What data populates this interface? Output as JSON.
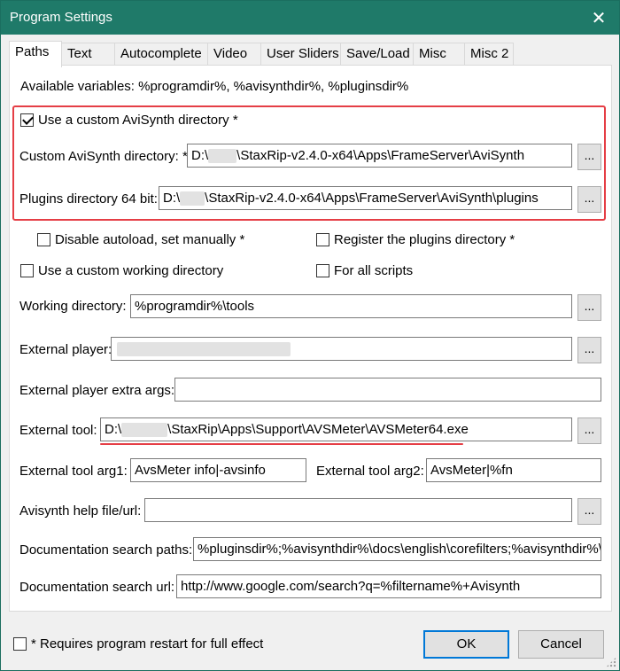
{
  "window": {
    "title": "Program Settings",
    "close_glyph": "✕"
  },
  "tabs": [
    {
      "label": "Paths",
      "active": true
    },
    {
      "label": "Text"
    },
    {
      "label": "Autocomplete"
    },
    {
      "label": "Video"
    },
    {
      "label": "User Sliders"
    },
    {
      "label": "Save/Load"
    },
    {
      "label": "Misc"
    },
    {
      "label": "Misc 2"
    }
  ],
  "paths": {
    "available_vars": "Available variables: %programdir%, %avisynthdir%, %pluginsdir%",
    "use_custom_avisynth_label": "Use a custom AviSynth directory *",
    "use_custom_avisynth_checked": true,
    "custom_avisynth_dir_label": "Custom AviSynth directory: *",
    "custom_avisynth_dir_prefix": "D:\\",
    "custom_avisynth_dir_suffix": "\\StaxRip-v2.4.0-x64\\Apps\\FrameServer\\AviSynth",
    "plugins_dir_label": "Plugins directory 64 bit:",
    "plugins_dir_prefix": "D:\\",
    "plugins_dir_suffix": "\\StaxRip-v2.4.0-x64\\Apps\\FrameServer\\AviSynth\\plugins",
    "disable_autoload_label": "Disable autoload, set manually *",
    "register_plugins_label": "Register the plugins directory *",
    "use_custom_working_label": "Use a custom working directory",
    "for_all_scripts_label": "For all scripts",
    "working_dir_label": "Working directory:",
    "working_dir_value": "%programdir%\\tools",
    "external_player_label": "External player:",
    "external_player_extra_label": "External player extra args:",
    "external_tool_label": "External tool:",
    "external_tool_prefix": "D:\\",
    "external_tool_suffix": "\\StaxRip\\Apps\\Support\\AVSMeter\\AVSMeter64.exe",
    "tool_arg1_label": "External tool arg1:",
    "tool_arg1_value": "AvsMeter info|-avsinfo",
    "tool_arg2_label": "External tool arg2:",
    "tool_arg2_value": "AvsMeter|%fn",
    "help_file_label": "Avisynth help file/url:",
    "doc_search_paths_label": "Documentation search paths:",
    "doc_search_paths_value": "%pluginsdir%;%avisynthdir%\\docs\\english\\corefilters;%avisynthdir%\\c",
    "doc_search_url_label": "Documentation search url:",
    "doc_search_url_value": "http://www.google.com/search?q=%filtername%+Avisynth",
    "browse_label": "..."
  },
  "footer": {
    "restart_note": "* Requires program restart for full effect",
    "ok_label": "OK",
    "cancel_label": "Cancel"
  },
  "colors": {
    "titlebar": "#1f7a69",
    "highlight": "#e53e45"
  }
}
